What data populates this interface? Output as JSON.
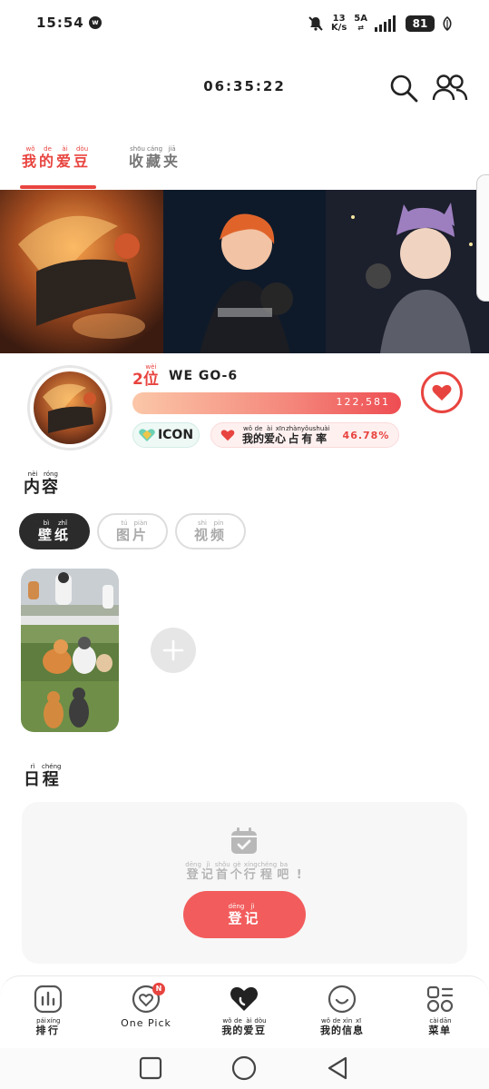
{
  "status_bar": {
    "time": "15:54",
    "app_icon": "w",
    "net_speed_value": "13",
    "net_speed_unit": "K/s",
    "network_type": "5A",
    "battery": "81"
  },
  "header": {
    "timer": "06:35:22",
    "search_icon": "search-icon",
    "people_icon": "people-icon"
  },
  "tabs": [
    {
      "label": [
        "我",
        "的",
        "爱",
        "豆"
      ],
      "pinyin": [
        "wǒ",
        "de",
        "ài",
        "dòu"
      ],
      "active": true
    },
    {
      "label": [
        "收",
        "藏",
        "夹"
      ],
      "pinyin": [
        "shōu",
        "cáng",
        "jiā"
      ],
      "active": false
    }
  ],
  "profile": {
    "rank_number": "2",
    "rank_char": "位",
    "rank_pinyin": "wèi",
    "name": "WE GO-6",
    "score": "122,581",
    "icon_badge": "ICON",
    "share_label": [
      "我",
      "的",
      "爱",
      "心",
      "占",
      "有",
      "率"
    ],
    "share_pinyin": [
      "wǒ",
      "de",
      "ài",
      "xīn",
      "zhàn",
      "yǒu",
      "shuài"
    ],
    "share_percent": "46.78%"
  },
  "content": {
    "title": [
      "内",
      "容"
    ],
    "title_pinyin": [
      "nèi",
      "róng"
    ],
    "pills": [
      {
        "label": [
          "壁",
          "纸"
        ],
        "pinyin": [
          "bì",
          "zhǐ"
        ],
        "active": true
      },
      {
        "label": [
          "图",
          "片"
        ],
        "pinyin": [
          "tú",
          "piàn"
        ],
        "active": false
      },
      {
        "label": [
          "视",
          "频"
        ],
        "pinyin": [
          "shì",
          "pín"
        ],
        "active": false
      }
    ]
  },
  "schedule": {
    "title": [
      "日",
      "程"
    ],
    "title_pinyin": [
      "rì",
      "chéng"
    ],
    "empty_text": [
      "登",
      "记",
      "首",
      "个",
      "行",
      "程",
      "吧"
    ],
    "empty_pinyin": [
      "dēng",
      "jì",
      "shǒu",
      "gè",
      "xíng",
      "chéng",
      "ba"
    ],
    "empty_suffix": "!",
    "button": [
      "登",
      "记"
    ],
    "button_pinyin": [
      "dēng",
      "jì"
    ]
  },
  "bottom_nav": [
    {
      "label": [
        "排",
        "行"
      ],
      "pinyin": [
        "pái",
        "xíng"
      ],
      "icon": "ranking-icon"
    },
    {
      "label": "One Pick",
      "icon": "heart-outline-icon",
      "badge": "N"
    },
    {
      "label": [
        "我",
        "的",
        "爱",
        "豆"
      ],
      "pinyin": [
        "wǒ",
        "de",
        "ài",
        "dòu"
      ],
      "icon": "heart-filled-icon"
    },
    {
      "label": [
        "我",
        "的",
        "信",
        "息"
      ],
      "pinyin": [
        "wǒ",
        "de",
        "xìn",
        "xī"
      ],
      "icon": "smile-icon"
    },
    {
      "label": [
        "菜",
        "单"
      ],
      "pinyin": [
        "cài",
        "dān"
      ],
      "icon": "menu-grid-icon"
    }
  ],
  "colors": {
    "accent": "#e8443f",
    "dark_pill": "#2b2b2b",
    "register": "#f25c5c"
  }
}
